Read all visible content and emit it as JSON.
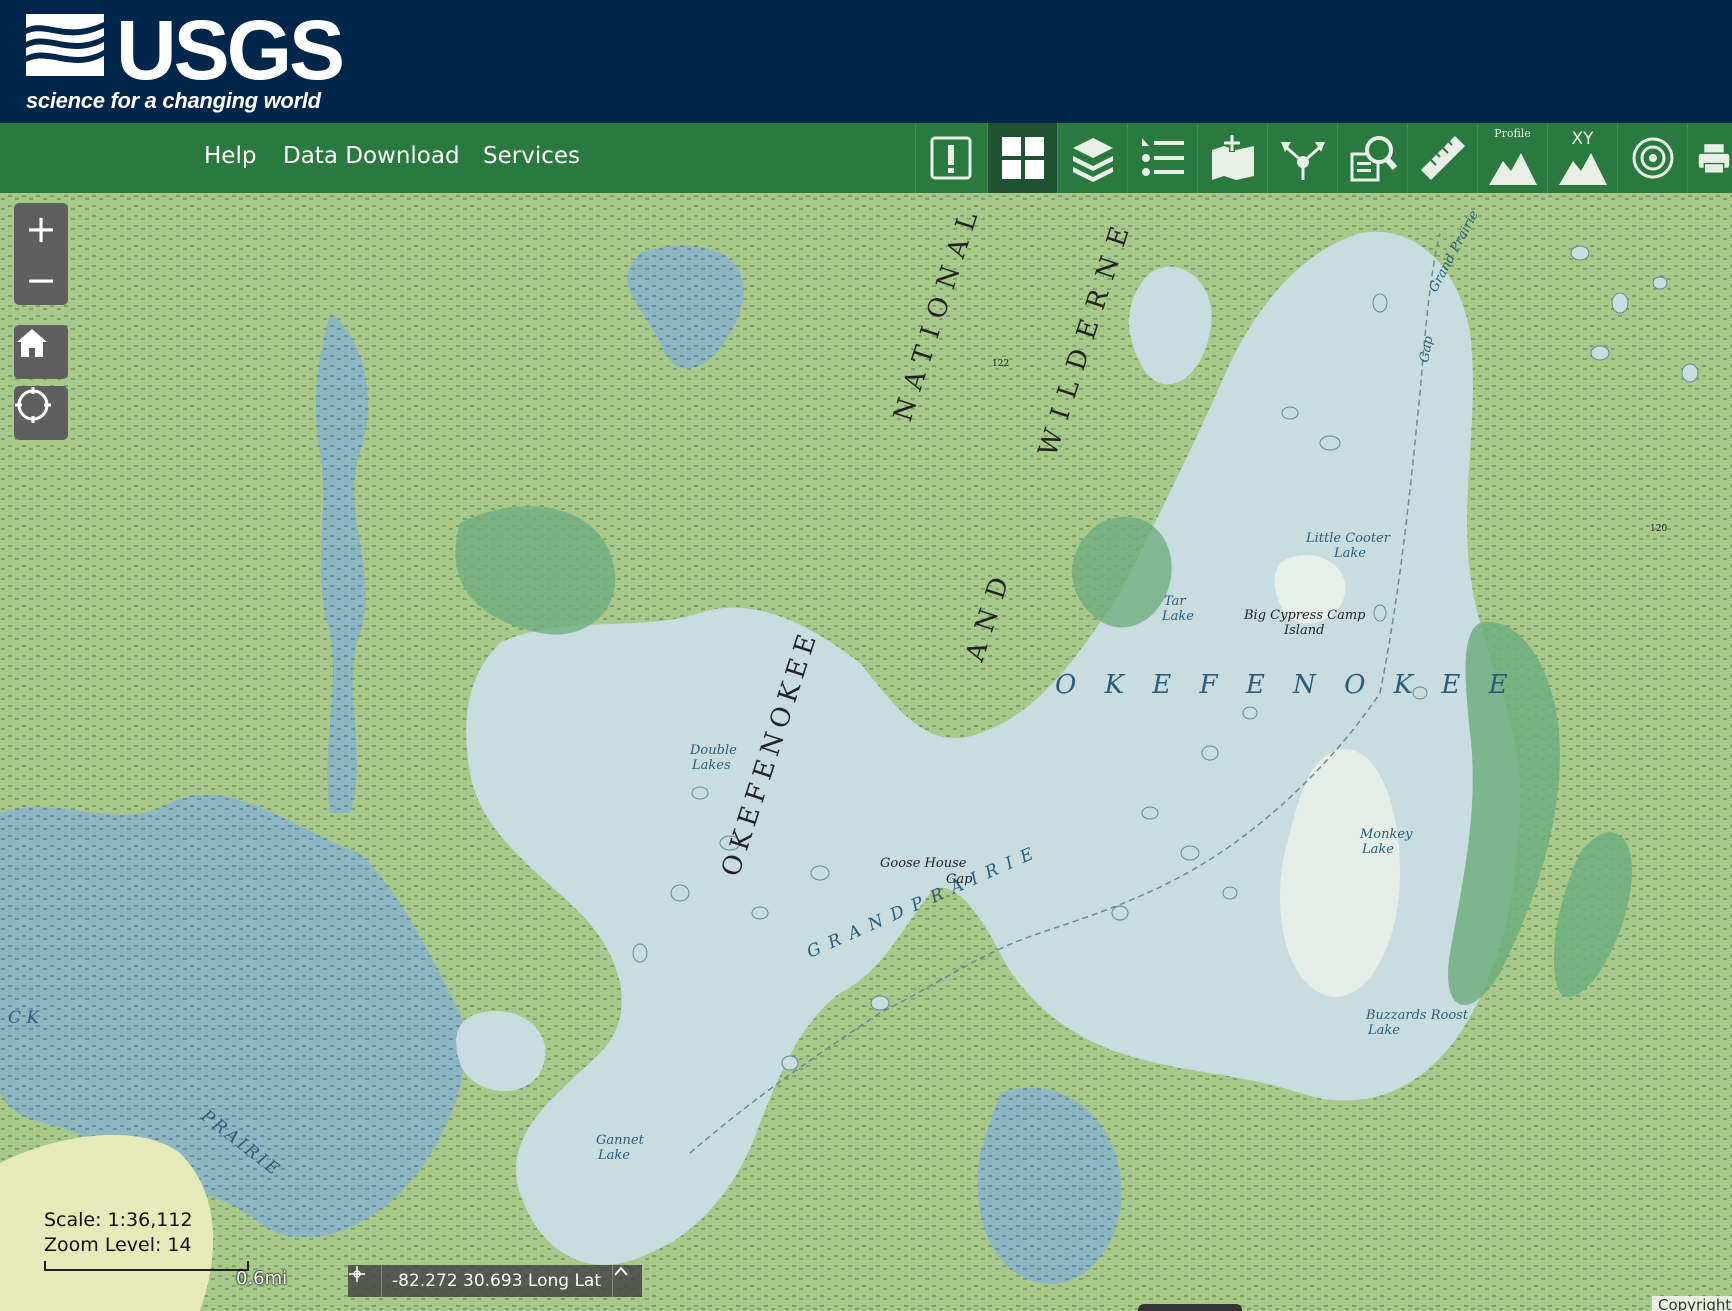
{
  "header": {
    "logo_text": "USGS",
    "tagline": "science for a changing world",
    "bg_color": "#00264c"
  },
  "navbar": {
    "bg_color": "#2a7a3f",
    "links": [
      "Help",
      "Data Download",
      "Services"
    ],
    "tools": [
      {
        "name": "alert-tool",
        "icon": "exclamation-icon",
        "label": ""
      },
      {
        "name": "basemap-gallery-tool",
        "icon": "grid-icon",
        "label": "",
        "active": true
      },
      {
        "name": "layers-tool",
        "icon": "layers-icon",
        "label": ""
      },
      {
        "name": "legend-tool",
        "icon": "list-icon",
        "label": ""
      },
      {
        "name": "add-data-tool",
        "icon": "map-add-icon",
        "label": ""
      },
      {
        "name": "share-tool",
        "icon": "share-icon",
        "label": ""
      },
      {
        "name": "query-tool",
        "icon": "search-document-icon",
        "label": ""
      },
      {
        "name": "measure-tool",
        "icon": "ruler-icon",
        "label": ""
      },
      {
        "name": "profile-tool",
        "icon": "mountain-icon",
        "label": "Profile"
      },
      {
        "name": "xy-tool",
        "icon": "mountain-icon",
        "label": "XY"
      },
      {
        "name": "spot-elevation-tool",
        "icon": "target-icon",
        "label": ""
      },
      {
        "name": "print-tool",
        "icon": "printer-icon",
        "label": ""
      }
    ]
  },
  "map": {
    "zoom_in": "+",
    "zoom_out": "−",
    "labels": {
      "okefenokee_diag": "OKEFENOKEE",
      "national": "NATIONAL",
      "and": "AND",
      "wilderness": "WILDERNE",
      "okefenokee_horiz": "O K E F E N O K E E",
      "grand_prairie_main": "G R A N D   P R A I R I E",
      "prairie_lower": "PRAIRIE",
      "ck": "C K",
      "grand_prairie_top": "Grand Prairie",
      "gap": "Gap",
      "double_lakes_1": "Double",
      "double_lakes_2": "Lakes",
      "goose_house_1": "Goose  House",
      "goose_house_2": "Gap",
      "little_cooter_1": "Little  Cooter",
      "little_cooter_2": "Lake",
      "tar_lake_1": "Tar",
      "tar_lake_2": "Lake",
      "big_cypress_1": "Big  Cypress  Camp",
      "big_cypress_2": "Island",
      "monkey_lake_1": "Monkey",
      "monkey_lake_2": "Lake",
      "buzzards_1": "Buzzards  Roost",
      "buzzards_2": "Lake",
      "gannet_1": "Gannet",
      "gannet_2": "Lake",
      "elev_122": "122",
      "elev_120": "120"
    },
    "colors": {
      "marsh": "#a9c98a",
      "water": "#c9dde0",
      "swamp_dark": "#6fae7f",
      "open_water_dark": "#8bb5c0"
    }
  },
  "scale": {
    "scale_text": "Scale: 1:36,112",
    "zoom_text": "Zoom Level: 14",
    "bar_label": "0.6mi"
  },
  "coordinates": {
    "text": "-82.272 30.693 Long Lat"
  },
  "copyright": "Copyright"
}
